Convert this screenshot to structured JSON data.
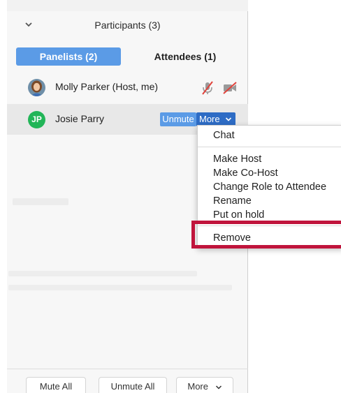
{
  "panel": {
    "title": "Participants (3)",
    "tabs": [
      {
        "label": "Panelists (2)",
        "active": true
      },
      {
        "label": "Attendees (1)",
        "active": false
      }
    ]
  },
  "participants": [
    {
      "name": "Molly Parker (Host, me)",
      "avatar": "photo",
      "mic": "muted",
      "video": "off"
    },
    {
      "name": "Josie Parry",
      "initials": "JP",
      "avatar_color": "#22b558",
      "unmute_label": "Unmute",
      "more_label": "More"
    }
  ],
  "context_menu": {
    "items": [
      "Chat",
      "Make Host",
      "Make Co-Host",
      "Change Role to Attendee",
      "Rename",
      "Put on hold",
      "Remove"
    ],
    "highlighted_item": "Remove",
    "highlight_color": "#c0143c"
  },
  "footer": {
    "mute_all": "Mute All",
    "unmute_all": "Unmute All",
    "more": "More"
  },
  "colors": {
    "accent": "#5b9be6",
    "more_button": "#2e6cc5",
    "muted_icon": "#e0413a"
  }
}
